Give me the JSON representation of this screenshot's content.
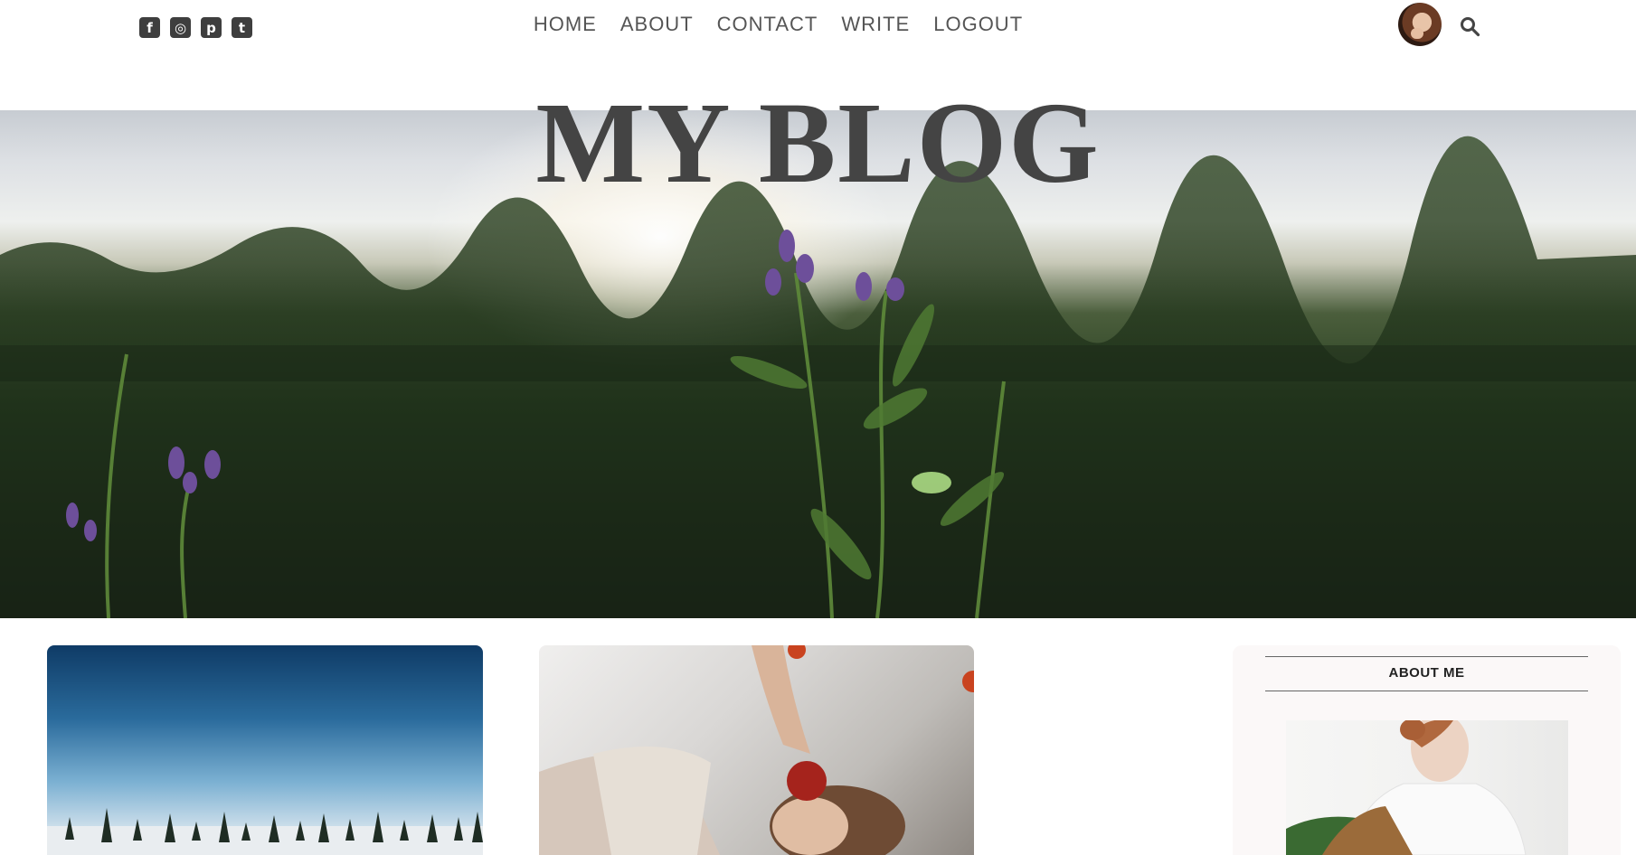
{
  "social": [
    {
      "name": "facebook",
      "glyph": "f"
    },
    {
      "name": "instagram",
      "glyph": "◎"
    },
    {
      "name": "pinterest",
      "glyph": "p"
    },
    {
      "name": "twitter",
      "glyph": "t"
    }
  ],
  "nav": {
    "items": [
      "HOME",
      "ABOUT",
      "CONTACT",
      "WRITE",
      "LOGOUT"
    ]
  },
  "header": {
    "title": "MY BLOG"
  },
  "sidebar": {
    "heading": "ABOUT ME"
  },
  "colors": {
    "text": "#444444",
    "icon": "#3e3e3e",
    "sidebar_bg": "#fbf8f8"
  }
}
